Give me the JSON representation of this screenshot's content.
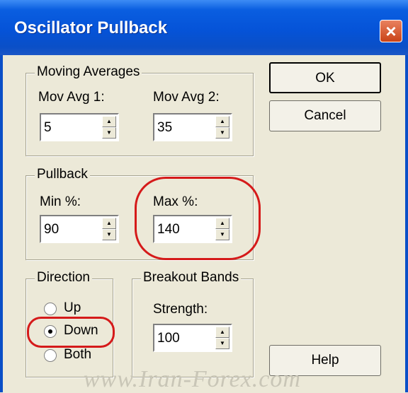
{
  "window": {
    "title": "Oscillator Pullback",
    "close_glyph": "×"
  },
  "moving_averages": {
    "legend": "Moving Averages",
    "avg1": {
      "label": "Mov Avg 1:",
      "value": "5"
    },
    "avg2": {
      "label": "Mov Avg 2:",
      "value": "35"
    }
  },
  "pullback": {
    "legend": "Pullback",
    "min": {
      "label": "Min %:",
      "value": "90"
    },
    "max": {
      "label": "Max %:",
      "value": "140"
    }
  },
  "direction": {
    "legend": "Direction",
    "options": [
      "Up",
      "Down",
      "Both"
    ],
    "selected": "Down"
  },
  "breakout": {
    "legend": "Breakout Bands",
    "strength": {
      "label": "Strength:",
      "value": "100"
    }
  },
  "buttons": {
    "ok": "OK",
    "cancel": "Cancel",
    "help": "Help"
  },
  "watermark": "www.Iran-Forex.com",
  "colors": {
    "title_bar": "#0553d8",
    "dialog_bg": "#ece9d8",
    "highlight_mark": "#d51a1a"
  }
}
